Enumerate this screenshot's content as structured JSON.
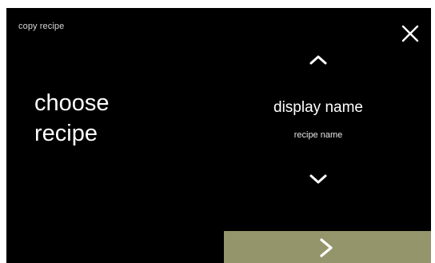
{
  "header": {
    "title": "copy recipe",
    "close_icon": "close-icon"
  },
  "prompt": {
    "line1": "choose",
    "line2": "recipe"
  },
  "selector": {
    "up_icon": "chevron-up-icon",
    "display_name": "display name",
    "recipe_name": "recipe name",
    "down_icon": "chevron-down-icon"
  },
  "footer": {
    "next_icon": "chevron-right-icon"
  },
  "colors": {
    "background": "#000000",
    "frame": "#ffffff",
    "accent_button": "#95956c",
    "text": "#ffffff"
  }
}
